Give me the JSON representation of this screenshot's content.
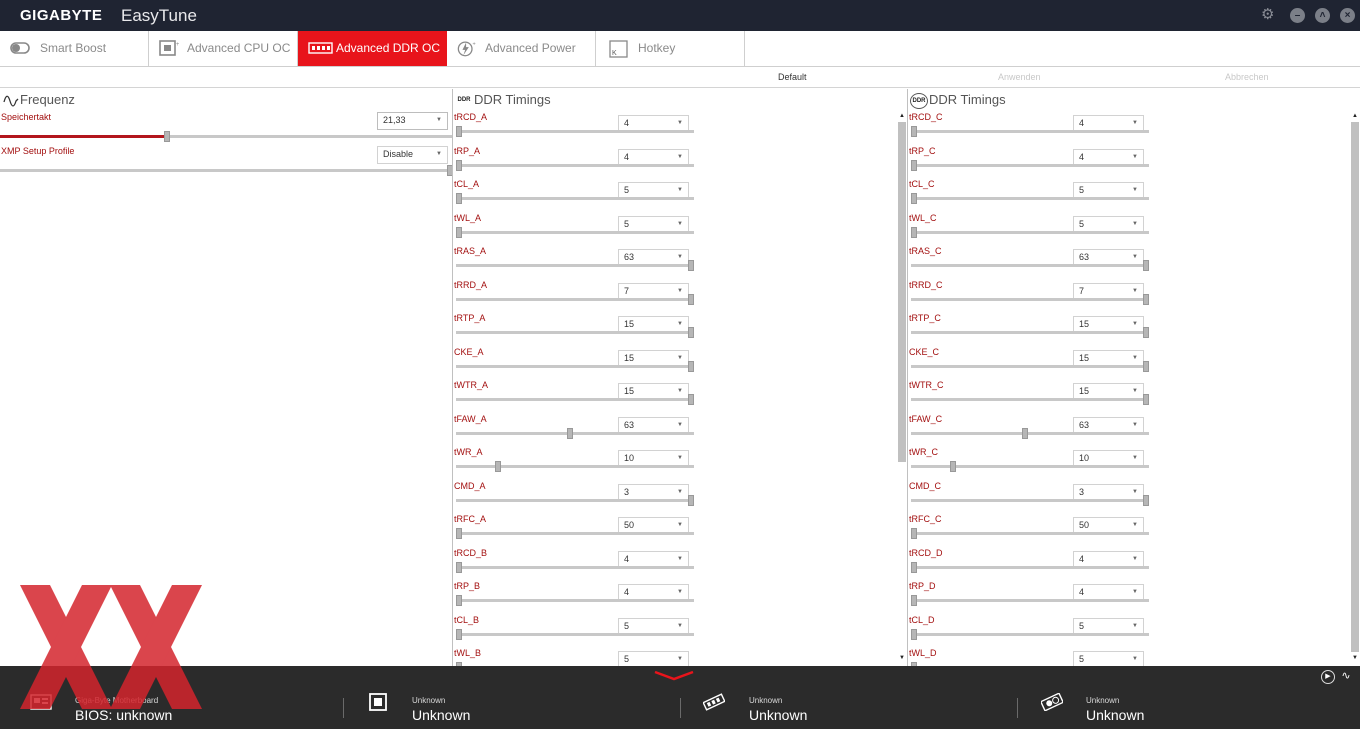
{
  "titlebar": {
    "brand": "GIGABYTE",
    "app": "EasyTune"
  },
  "tabs": [
    {
      "label": "Smart Boost",
      "active": false,
      "icon": "toggle-icon"
    },
    {
      "label": "Advanced CPU OC",
      "active": false,
      "icon": "cpu-icon"
    },
    {
      "label": "Advanced DDR OC",
      "active": true,
      "icon": "memory-icon"
    },
    {
      "label": "Advanced Power",
      "active": false,
      "icon": "power-icon"
    },
    {
      "label": "Hotkey",
      "active": false,
      "icon": "keyboard-icon"
    }
  ],
  "actions": {
    "default": "Default",
    "apply": "Anwenden",
    "cancel": "Abbrechen"
  },
  "freq": {
    "title": "Frequenz",
    "speichertakt": {
      "label": "Speichertakt",
      "value": "21,33",
      "level": 0.7
    },
    "xmp": {
      "label": "XMP Setup Profile",
      "value": "Disable",
      "level": 1.0
    }
  },
  "ddr_left": {
    "title": "DDR Timings",
    "icon_label": "DDR",
    "rows": [
      {
        "label": "tRCD_A",
        "value": "4",
        "level": 0.0
      },
      {
        "label": "tRP_A",
        "value": "4",
        "level": 0.0
      },
      {
        "label": "tCL_A",
        "value": "5",
        "level": 0.0
      },
      {
        "label": "tWL_A",
        "value": "5",
        "level": 0.0
      },
      {
        "label": "tRAS_A",
        "value": "63",
        "level": 1.0
      },
      {
        "label": "tRRD_A",
        "value": "7",
        "level": 1.0
      },
      {
        "label": "tRTP_A",
        "value": "15",
        "level": 1.0
      },
      {
        "label": "CKE_A",
        "value": "15",
        "level": 1.0
      },
      {
        "label": "tWTR_A",
        "value": "15",
        "level": 1.0
      },
      {
        "label": "tFAW_A",
        "value": "63",
        "level": 0.48
      },
      {
        "label": "tWR_A",
        "value": "10",
        "level": 0.17
      },
      {
        "label": "CMD_A",
        "value": "3",
        "level": 1.0
      },
      {
        "label": "tRFC_A",
        "value": "50",
        "level": 0.0
      },
      {
        "label": "tRCD_B",
        "value": "4",
        "level": 0.0
      },
      {
        "label": "tRP_B",
        "value": "4",
        "level": 0.0
      },
      {
        "label": "tCL_B",
        "value": "5",
        "level": 0.0
      },
      {
        "label": "tWL_B",
        "value": "5",
        "level": 0.0
      }
    ]
  },
  "ddr_right": {
    "title": "DDR Timings",
    "icon_label": "DDR",
    "rows": [
      {
        "label": "tRCD_C",
        "value": "4",
        "level": 0.0
      },
      {
        "label": "tRP_C",
        "value": "4",
        "level": 0.0
      },
      {
        "label": "tCL_C",
        "value": "5",
        "level": 0.0
      },
      {
        "label": "tWL_C",
        "value": "5",
        "level": 0.0
      },
      {
        "label": "tRAS_C",
        "value": "63",
        "level": 1.0
      },
      {
        "label": "tRRD_C",
        "value": "7",
        "level": 1.0
      },
      {
        "label": "tRTP_C",
        "value": "15",
        "level": 1.0
      },
      {
        "label": "CKE_C",
        "value": "15",
        "level": 1.0
      },
      {
        "label": "tWTR_C",
        "value": "15",
        "level": 1.0
      },
      {
        "label": "tFAW_C",
        "value": "63",
        "level": 0.48
      },
      {
        "label": "tWR_C",
        "value": "10",
        "level": 0.17
      },
      {
        "label": "CMD_C",
        "value": "3",
        "level": 1.0
      },
      {
        "label": "tRFC_C",
        "value": "50",
        "level": 0.0
      },
      {
        "label": "tRCD_D",
        "value": "4",
        "level": 0.0
      },
      {
        "label": "tRP_D",
        "value": "4",
        "level": 0.0
      },
      {
        "label": "tCL_D",
        "value": "5",
        "level": 0.0
      },
      {
        "label": "tWL_D",
        "value": "5",
        "level": 0.0
      }
    ]
  },
  "bottom": [
    {
      "small": "Giga-Byte Motherboard",
      "big": "BIOS: unknown",
      "icon": "motherboard-icon"
    },
    {
      "small": "Unknown",
      "big": "Unknown",
      "icon": "cpu-chip-icon"
    },
    {
      "small": "Unknown",
      "big": "Unknown",
      "icon": "ram-icon"
    },
    {
      "small": "Unknown",
      "big": "Unknown",
      "icon": "graphics-card-icon"
    }
  ],
  "colors": {
    "accent": "#e8141b",
    "label": "#a31010",
    "titlebar": "#1f2432",
    "statusbar": "#2b2b2b"
  }
}
